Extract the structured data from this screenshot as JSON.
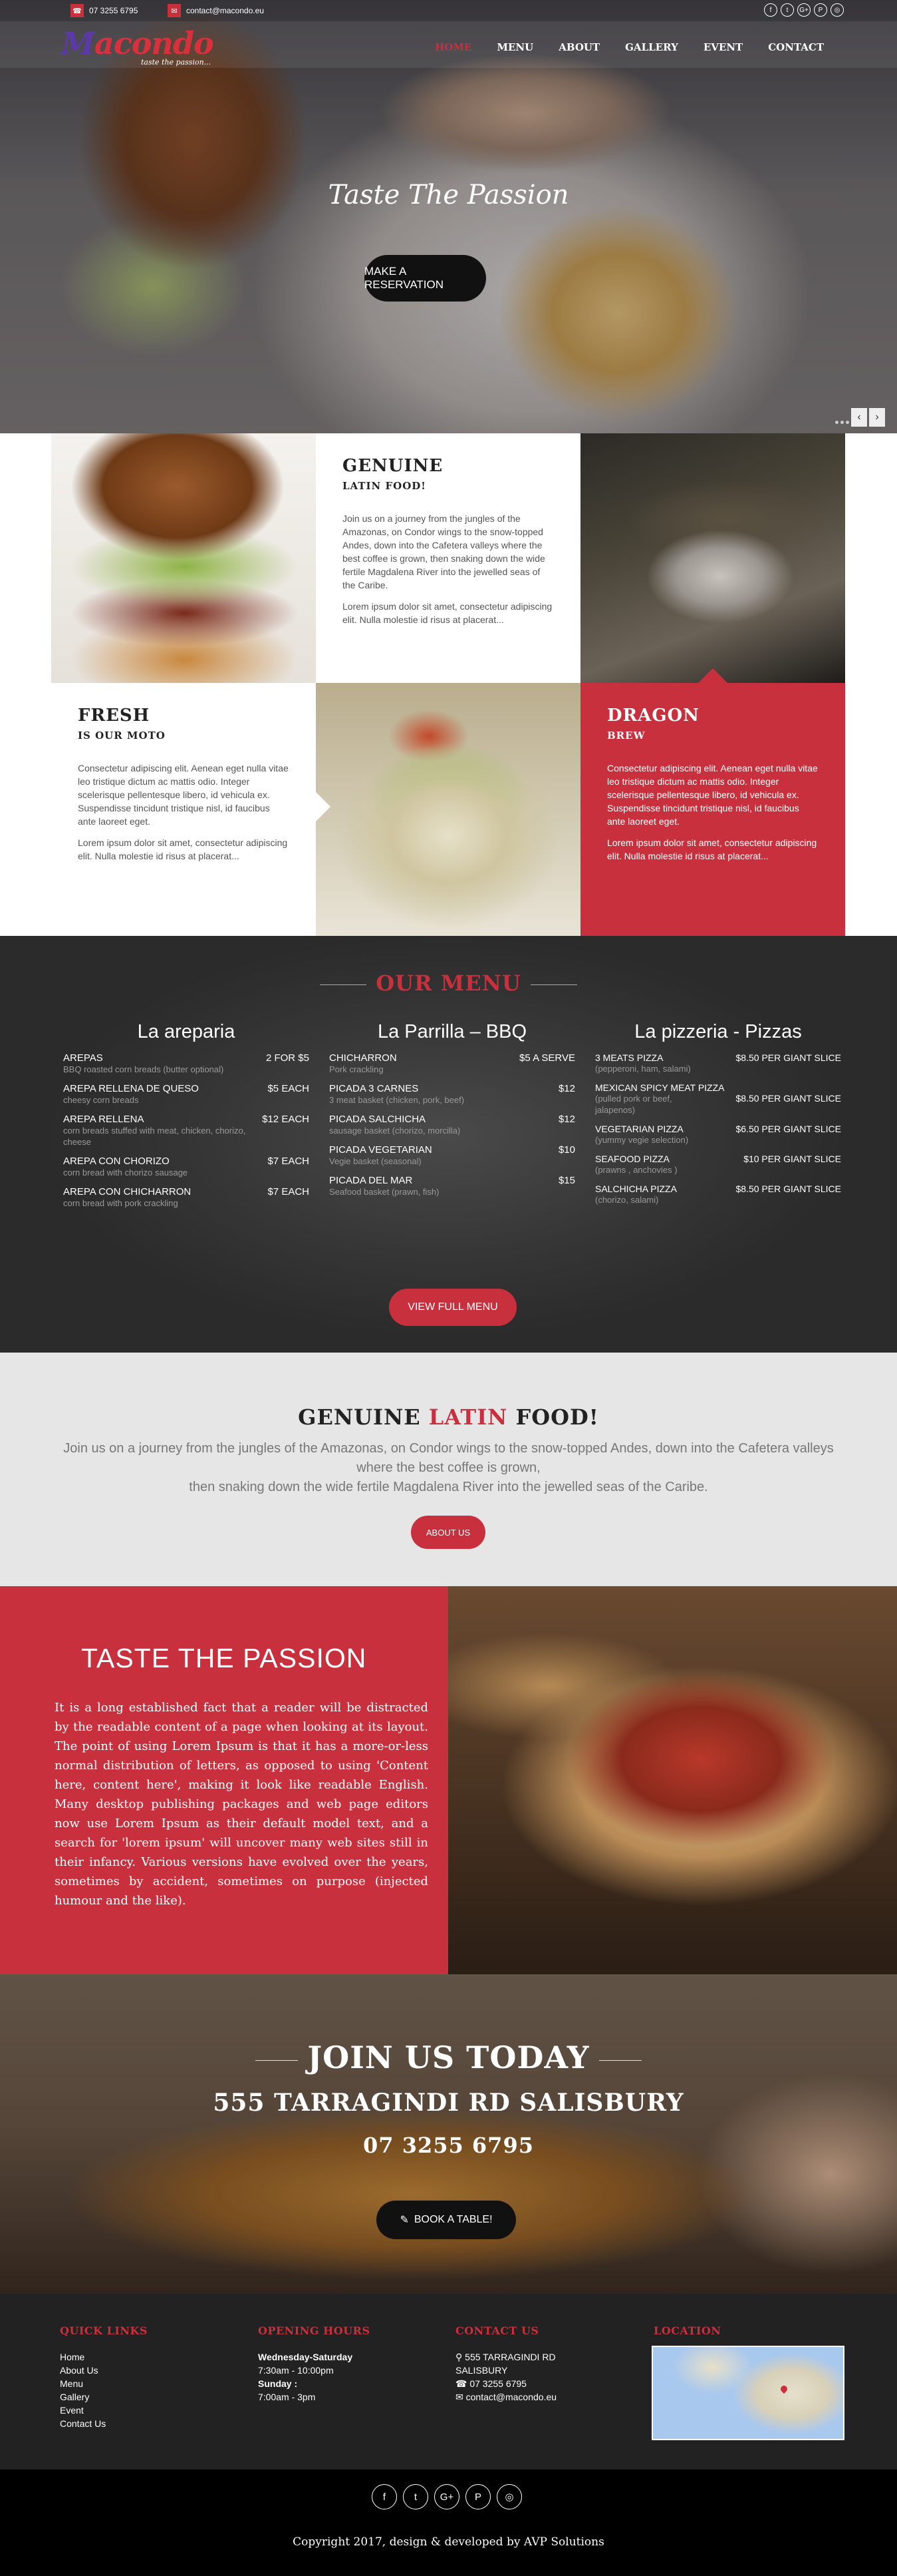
{
  "topbar": {
    "phone": "07 3255 6795",
    "email": "contact@macondo.eu",
    "phone_icon": "☎",
    "email_icon": "✉",
    "socials": [
      "f",
      "t",
      "G+",
      "P",
      "◎"
    ]
  },
  "brand": {
    "logo_m": "M",
    "logo_rest": "acondo",
    "tagline": "taste the passion..."
  },
  "nav": [
    "HOME",
    "MENU",
    "ABOUT",
    "GALLERY",
    "EVENT",
    "CONTACT"
  ],
  "hero": {
    "title": "Taste The Passion",
    "button": "MAKE A RESERVATION"
  },
  "features": {
    "genuine": {
      "title": "GENUINE",
      "subtitle": "LATIN FOOD!",
      "p1": "Join us on a journey from the jungles of the Amazonas, on Condor wings to the snow-topped Andes, down into the Cafetera valleys where the best coffee is grown, then snaking down the wide fertile Magdalena River into the jewelled seas of the Caribe.",
      "p2": "Lorem ipsum dolor sit amet, consectetur adipiscing elit. Nulla molestie id risus at placerat..."
    },
    "fresh": {
      "title": "FRESH",
      "subtitle": "IS OUR MOTO",
      "p1": "Consectetur adipiscing elit. Aenean eget nulla vitae leo tristique dictum ac mattis odio. Integer scelerisque pellentesque libero, id vehicula ex. Suspendisse tincidunt tristique nisl, id faucibus ante laoreet eget.",
      "p2": "Lorem ipsum dolor sit amet, consectetur adipiscing elit. Nulla molestie id risus at placerat..."
    },
    "dragon": {
      "title": "DRAGON",
      "subtitle": "BREW",
      "p1": "Consectetur adipiscing elit. Aenean eget nulla vitae leo tristique dictum ac mattis odio. Integer scelerisque pellentesque libero, id vehicula ex. Suspendisse tincidunt tristique nisl, id faucibus ante laoreet eget.",
      "p2": "Lorem ipsum dolor sit amet, consectetur adipiscing elit. Nulla molestie id risus at placerat..."
    }
  },
  "menu": {
    "title": "OUR MENU",
    "button": "VIEW FULL MENU",
    "columns": [
      {
        "heading": "La areparia",
        "items": [
          {
            "name": "AREPAS",
            "price": "2 FOR $5",
            "desc": "BBQ roasted corn breads (butter optional)"
          },
          {
            "name": "AREPA RELLENA DE QUESO",
            "price": "$5 EACH",
            "desc": "cheesy corn breads"
          },
          {
            "name": "AREPA RELLENA",
            "price": "$12 EACH",
            "desc": "corn breads stuffed with meat, chicken, chorizo, cheese"
          },
          {
            "name": "AREPA CON CHORIZO",
            "price": "$7 EACH",
            "desc": "corn bread with chorizo sausage"
          },
          {
            "name": "AREPA CON CHICHARRON",
            "price": "$7 EACH",
            "desc": "corn bread with pork crackling"
          }
        ]
      },
      {
        "heading": "La Parrilla – BBQ",
        "items": [
          {
            "name": "CHICHARRON",
            "price": "$5 A SERVE",
            "desc": "Pork crackling"
          },
          {
            "name": "PICADA 3 CARNES",
            "price": "$12",
            "desc": "3 meat basket (chicken, pork, beef)"
          },
          {
            "name": "PICADA SALCHICHA",
            "price": "$12",
            "desc": "sausage basket (chorizo, morcilla)"
          },
          {
            "name": "PICADA VEGETARIAN",
            "price": "$10",
            "desc": "Vegie basket (seasonal)"
          },
          {
            "name": "PICADA DEL MAR",
            "price": "$15",
            "desc": "Seafood basket (prawn, fish)"
          }
        ]
      },
      {
        "heading": "La pizzeria - Pizzas",
        "items": [
          {
            "name": "3 MEATS PIZZA",
            "price": "$8.50 PER GIANT SLICE",
            "desc": "(pepperoni, ham, salami)"
          },
          {
            "name": "MEXICAN SPICY MEAT PIZZA",
            "price": "$8.50 PER GIANT SLICE",
            "desc": "(pulled pork or beef, jalapenos)"
          },
          {
            "name": "VEGETARIAN PIZZA",
            "price": "$6.50 PER GIANT SLICE",
            "desc": "(yummy vegie selection)"
          },
          {
            "name": "SEAFOOD PIZZA",
            "price": "$10 PER GIANT SLICE",
            "desc": "(prawns , anchovies )"
          },
          {
            "name": "SALCHICHA PIZZA",
            "price": "$8.50 PER GIANT SLICE",
            "desc": "(chorizo, salami)"
          }
        ]
      }
    ]
  },
  "about": {
    "title_a": "GENUINE ",
    "title_b": "LATIN",
    "title_c": " FOOD!",
    "line1": "Join us on a journey from the jungles of the Amazonas, on Condor wings to the snow-topped Andes, down into the Cafetera valleys where the best coffee is grown,",
    "line2": "then snaking down the wide fertile Magdalena River into the jewelled seas of the Caribe.",
    "button": "ABOUT US"
  },
  "passion": {
    "title": "TASTE THE PASSION",
    "text": "It is a long established fact that a reader will be distracted by the readable content of a page when looking at its layout. The point of using Lorem Ipsum is that it has a more-or-less normal distribution of letters, as opposed to using 'Content here, content here', making it look like readable English. Many desktop publishing packages and web page editors now use Lorem Ipsum as their default model text, and a search for 'lorem ipsum' will uncover many web sites still in their infancy. Various versions have evolved over the years, sometimes by accident, sometimes on purpose (injected humour and the like)."
  },
  "join": {
    "title": "JOIN US TODAY",
    "address": "555 TARRAGINDI RD SALISBURY",
    "phone": "07 3255 6795",
    "button": "BOOK A TABLE!"
  },
  "footer": {
    "quick_links_title": "QUICK LINKS",
    "quick_links": [
      "Home",
      "About Us",
      "Menu",
      "Gallery",
      "Event",
      "Contact Us"
    ],
    "hours_title": "OPENING HOURS",
    "hours": [
      {
        "day": "Wednesday-Saturday",
        "time": "7:30am - 10:00pm"
      },
      {
        "day": "Sunday :",
        "time": "7:00am - 3pm"
      }
    ],
    "contact_title": "CONTACT US",
    "contact_address_1": "555 TARRAGINDI RD",
    "contact_address_2": "SALISBURY",
    "contact_phone": "07 3255 6795",
    "contact_email": "contact@macondo.eu",
    "location_title": "LOCATION"
  },
  "bottom": {
    "socials": [
      "f",
      "t",
      "G+",
      "P",
      "◎"
    ],
    "copyright": "Copyright 2017, design & developed by AVP Solutions"
  },
  "colors": {
    "accent": "#c9303d",
    "dark": "#222222"
  }
}
